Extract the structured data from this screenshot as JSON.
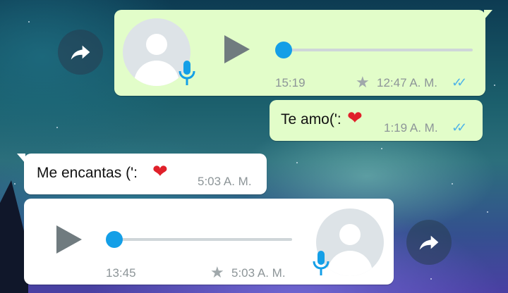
{
  "messages": [
    {
      "type": "voice",
      "direction": "outgoing",
      "duration": "15:19",
      "time": "12:47 A. M.",
      "starred": true,
      "read_receipt": "✓✓",
      "progress": 0
    },
    {
      "type": "text",
      "direction": "outgoing",
      "text": "Te amo(':",
      "emoji": "❤",
      "time": "1:19 A. M.",
      "read_receipt": "✓✓"
    },
    {
      "type": "text",
      "direction": "incoming",
      "text": "Me encantas (':",
      "emoji": "❤",
      "time": "5:03 A. M."
    },
    {
      "type": "voice",
      "direction": "incoming",
      "duration": "13:45",
      "time": "5:03 A. M.",
      "starred": true,
      "progress": 0
    }
  ],
  "icons": {
    "forward": "forward-icon",
    "play": "play-icon",
    "mic": "microphone-icon",
    "star": "★",
    "avatar": "default-avatar-icon"
  },
  "colors": {
    "outgoing_bubble": "#e2fdc9",
    "incoming_bubble": "#ffffff",
    "accent_blue": "#149fe7",
    "read_tick_blue": "#4fb4e8",
    "heart_red": "#e0202a"
  }
}
